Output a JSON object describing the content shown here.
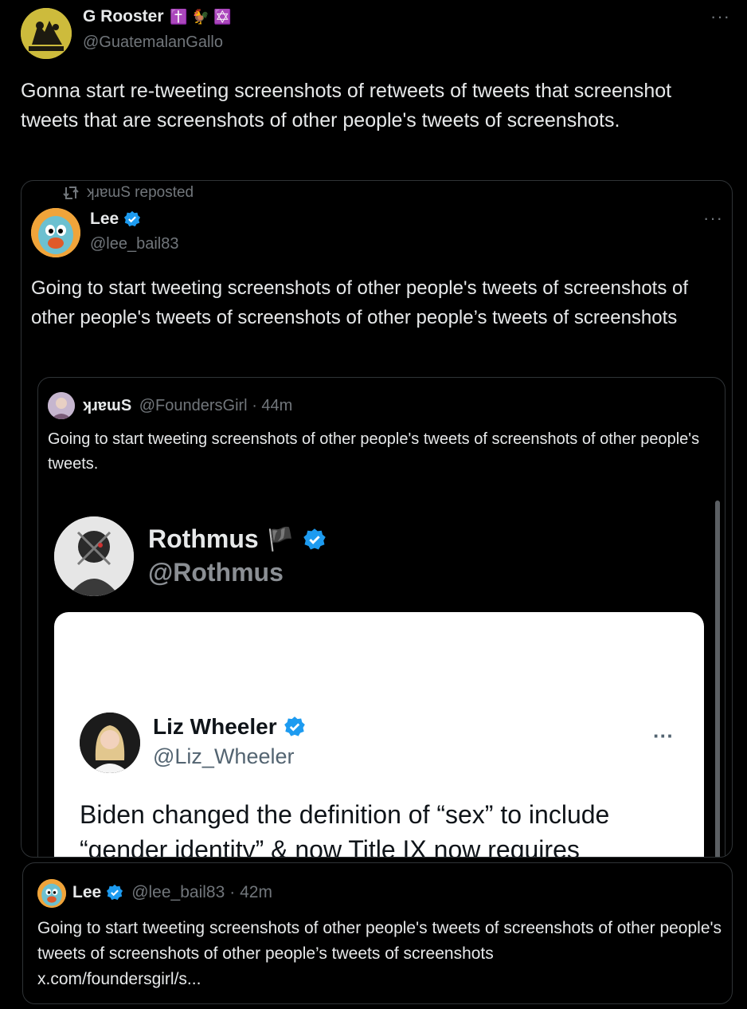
{
  "main_tweet": {
    "display_name": "G Rooster",
    "name_emojis": "✝️ 🐓 ✡️",
    "handle": "@GuatemalanGallo",
    "text": "Gonna start re-tweeting screenshots of retweets of tweets that screenshot tweets that are screenshots of other people's tweets of screenshots.",
    "more_label": "···"
  },
  "repost_card": {
    "repost_label": "ʞɹɐɯS reposted",
    "display_name": "Lee",
    "handle": "@lee_bail83",
    "more_label": "···",
    "text": "Going to start tweeting screenshots of other people's tweets of screenshots of other people's tweets of screenshots of other people’s tweets of screenshots"
  },
  "quoted_tweet": {
    "display_name": "ʞɹɐɯS",
    "handle": "@FoundersGirl",
    "time": "· 44m",
    "text": "Going to start tweeting screenshots of other people's tweets of screenshots of other people's tweets."
  },
  "screenshot_image": {
    "outer_name": "Rothmus",
    "outer_flag": "🏴",
    "outer_handle": "@Rothmus",
    "inner_name": "Liz Wheeler",
    "inner_handle": "@Liz_Wheeler",
    "inner_more": "···",
    "inner_text": "Biden changed the definition of “sex” to include “gender identity” & now Title IX now requires"
  },
  "bottom_quote": {
    "display_name": "Lee",
    "handle": "@lee_bail83",
    "time": "· 42m",
    "text": "Going to start tweeting screenshots of other people's tweets of screenshots of other people's tweets of screenshots of other people’s tweets of screenshots",
    "link": "x.com/foundersgirl/s..."
  },
  "colors": {
    "verified_blue": "#1d9bf0",
    "background": "#000000",
    "border": "#2f3336",
    "muted_text": "#71767b"
  }
}
